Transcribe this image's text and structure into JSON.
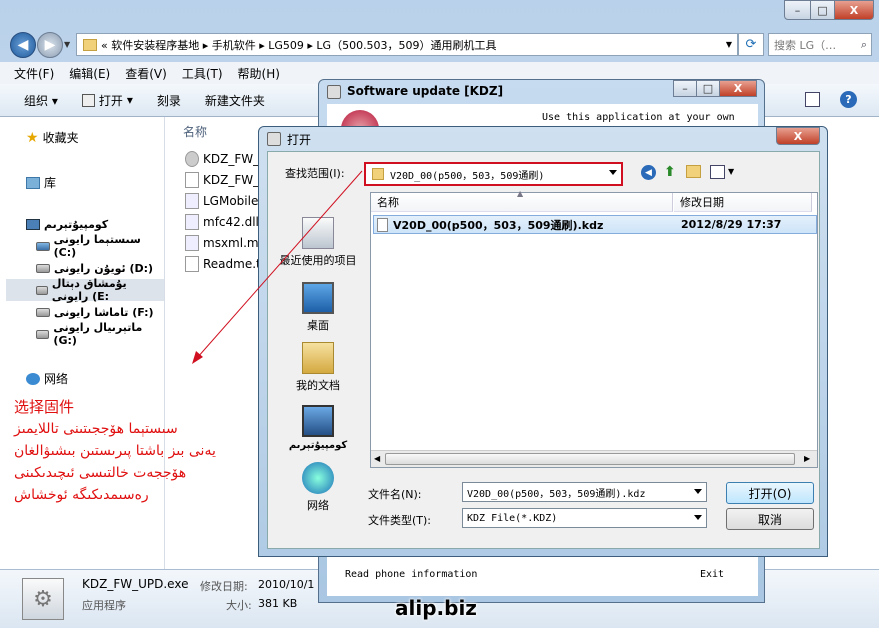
{
  "explorer": {
    "caption_buttons": [
      "–",
      "□",
      "X"
    ],
    "address_path": "« 软件安装程序基地 ▸ 手机软件 ▸ LG509 ▸ LG（500.503，509）通用刷机工具",
    "search_placeholder": "搜索 LG（…",
    "menu": [
      "文件(F)",
      "编辑(E)",
      "查看(V)",
      "工具(T)",
      "帮助(H)"
    ],
    "toolbar": {
      "organize": "组织",
      "open": "打开",
      "burn": "刻录",
      "new_folder": "新建文件夹"
    },
    "sidebar": {
      "favorites": "收藏夹",
      "libraries": "库",
      "computer": "كومپيۇتېرىم",
      "drives": [
        "سىستېما رايونى (C:)",
        "ئويۇن رايونى (D:)",
        "يۇمشاق دېتال رايونى (E:",
        "تاماشا رايونى (F:)",
        "ماتېرىيال رايونى (G:)"
      ],
      "network": "网络"
    },
    "column_name": "名称",
    "files": [
      "KDZ_FW_",
      "KDZ_FW_",
      "LGMobile",
      "mfc42.dll",
      "msxml.m",
      "Readme.t"
    ],
    "details": {
      "name": "KDZ_FW_UPD.exe",
      "modified_label": "修改日期:",
      "modified_value": "2010/10/1",
      "type": "应用程序",
      "size_label": "大小:",
      "size_value": "381 KB"
    }
  },
  "annotation": {
    "title": "选择固件",
    "lines": [
      "سىستېما ھۆججىتىنى تاللايمىز",
      "يەنى بىز باشتا پىرىستىن بىشىۋالغان",
      "ھۆججەت خالتىسى ئىچىدىكىنى",
      "رەسىمدىكىگە ئوخشاش"
    ]
  },
  "kdz_window": {
    "title": "Software update [KDZ]",
    "use_text": "Use this application at your own",
    "footer_left": "Read phone information",
    "footer_right": "Exit"
  },
  "open_dialog": {
    "title": "打开",
    "lookin_label": "查找范围(I):",
    "lookin_value": "V20D_00(p500，503，509通刷)",
    "places": [
      "最近使用的项目",
      "桌面",
      "我的文档",
      "كومپيۇتېرىم",
      "网络"
    ],
    "col_name": "名称",
    "col_date": "修改日期",
    "file_name": "V20D_00(p500，503，509通刷).kdz",
    "file_date": "2012/8/29 17:37",
    "filename_label": "文件名(N):",
    "filename_value": "V20D_00(p500，503，509通刷).kdz",
    "filetype_label": "文件类型(T):",
    "filetype_value": "KDZ File(*.KDZ)",
    "open_button": "打开(O)",
    "cancel_button": "取消",
    "close": "X"
  },
  "watermark": "alip.biz",
  "colors": {
    "annotation": "#e01010",
    "highlight": "#d01020",
    "title_bar": "#c4d8ea"
  }
}
